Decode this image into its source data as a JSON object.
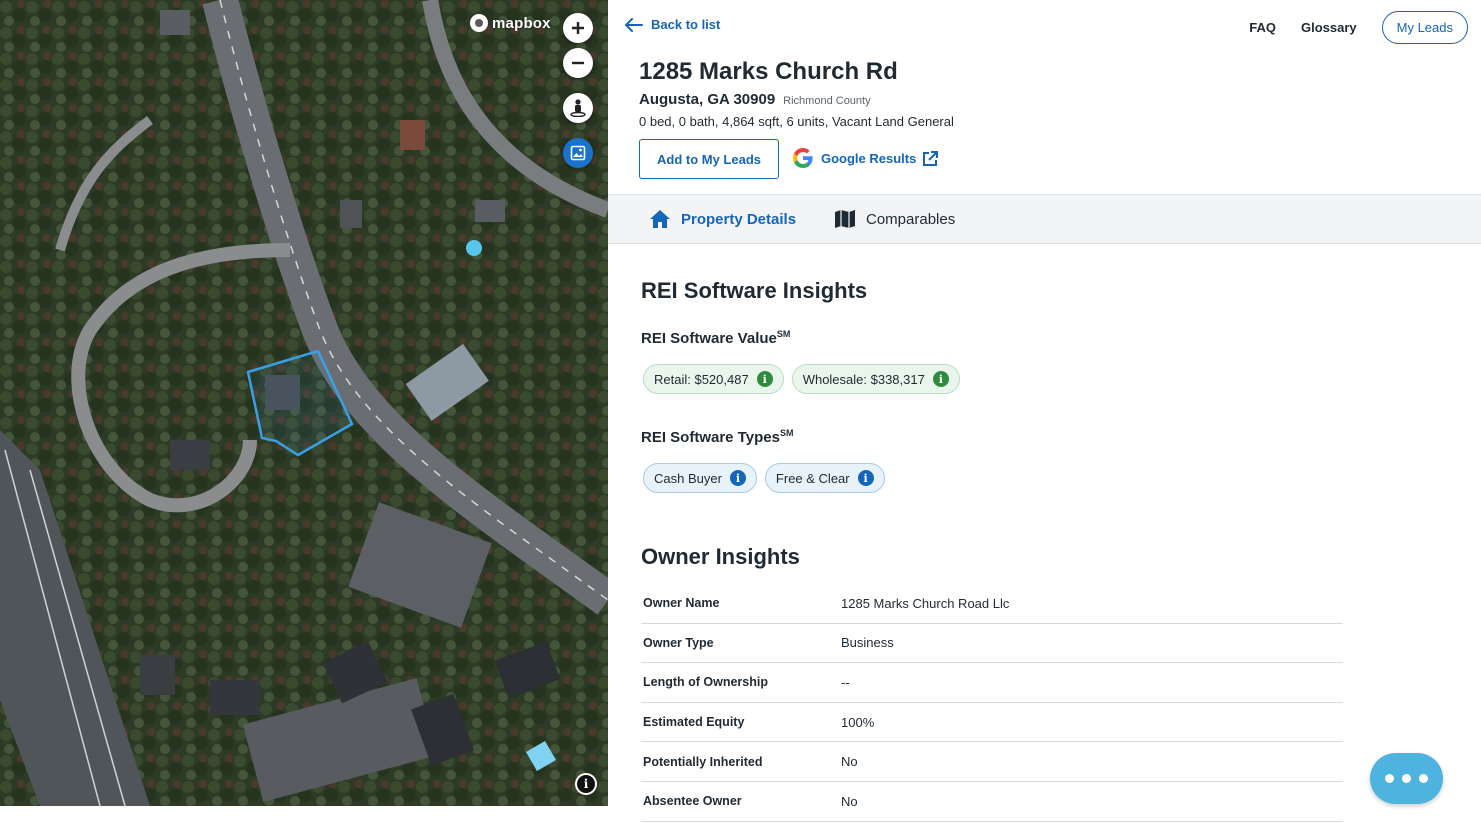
{
  "map": {
    "brand": "mapbox",
    "controls": [
      "zoom-in",
      "zoom-out",
      "street-view",
      "satellite"
    ]
  },
  "header": {
    "back_label": "Back to list",
    "faq": "FAQ",
    "glossary": "Glossary",
    "my_leads": "My Leads"
  },
  "property": {
    "address": "1285 Marks Church Rd",
    "city_line": "Augusta, GA 30909",
    "county": "Richmond County",
    "facts": "0 bed, 0 bath, 4,864 sqft, 6 units, Vacant Land General",
    "add_to_leads": "Add to My Leads",
    "google_results": "Google Results"
  },
  "tabs": [
    {
      "label": "Property Details",
      "active": true
    },
    {
      "label": "Comparables",
      "active": false
    }
  ],
  "insights": {
    "title": "REI Software Insights",
    "value_heading": "REI Software Value",
    "value_sup": "SM",
    "values": [
      {
        "label": "Retail: $520,487"
      },
      {
        "label": "Wholesale: $338,317"
      }
    ],
    "types_heading": "REI Software Types",
    "types_sup": "SM",
    "types": [
      {
        "label": "Cash Buyer"
      },
      {
        "label": "Free & Clear"
      }
    ]
  },
  "owner": {
    "title": "Owner Insights",
    "rows": [
      {
        "key": "Owner Name",
        "value": "1285 Marks Church Road Llc"
      },
      {
        "key": "Owner Type",
        "value": "Business"
      },
      {
        "key": "Length of Ownership",
        "value": "--"
      },
      {
        "key": "Estimated Equity",
        "value": "100%"
      },
      {
        "key": "Potentially Inherited",
        "value": "No"
      },
      {
        "key": "Absentee Owner",
        "value": "No"
      }
    ]
  },
  "colors": {
    "accent": "#1565b8",
    "green_chip": "#2e8b3d",
    "fab": "#4fb3df",
    "parcel_outline": "#3aa0e6"
  }
}
